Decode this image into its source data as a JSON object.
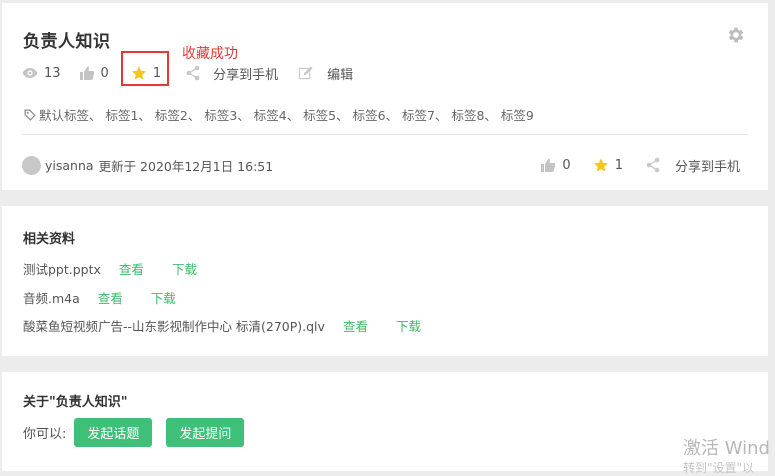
{
  "document": {
    "title": "负责人知识",
    "views": "13",
    "likes": "0",
    "favorites": "1",
    "share_label": "分享到手机",
    "edit_label": "编辑",
    "favorite_success": "收藏成功",
    "tags": "默认标签、 标签1、 标签2、 标签3、 标签4、 标签5、 标签6、 标签7、 标签8、 标签9",
    "author": "yisanna",
    "updated_text": "更新于 2020年12月1日 16:51",
    "footer_likes": "0",
    "footer_favorites": "1",
    "footer_share_label": "分享到手机"
  },
  "related": {
    "title": "相关资料",
    "files": [
      {
        "name": "测试ppt.pptx",
        "view": "查看",
        "download": "下载"
      },
      {
        "name": "音频.m4a",
        "view": "查看",
        "download": "下载"
      },
      {
        "name": "酸菜鱼短视频广告--山东影视制作中心 标清(270P).qlv",
        "view": "查看",
        "download": "下载"
      }
    ]
  },
  "about": {
    "title": "关于\"负责人知识\"",
    "prompt": "你可以:",
    "start_topic": "发起话题",
    "start_question": "发起提问"
  },
  "watermark": {
    "line1": "激活 Wind",
    "line2": "转到\"设置\"以"
  },
  "colors": {
    "accent_green": "#3fc078",
    "link_green": "#3dbb6b",
    "annotation_red": "#e53935",
    "star": "#f5c518"
  }
}
